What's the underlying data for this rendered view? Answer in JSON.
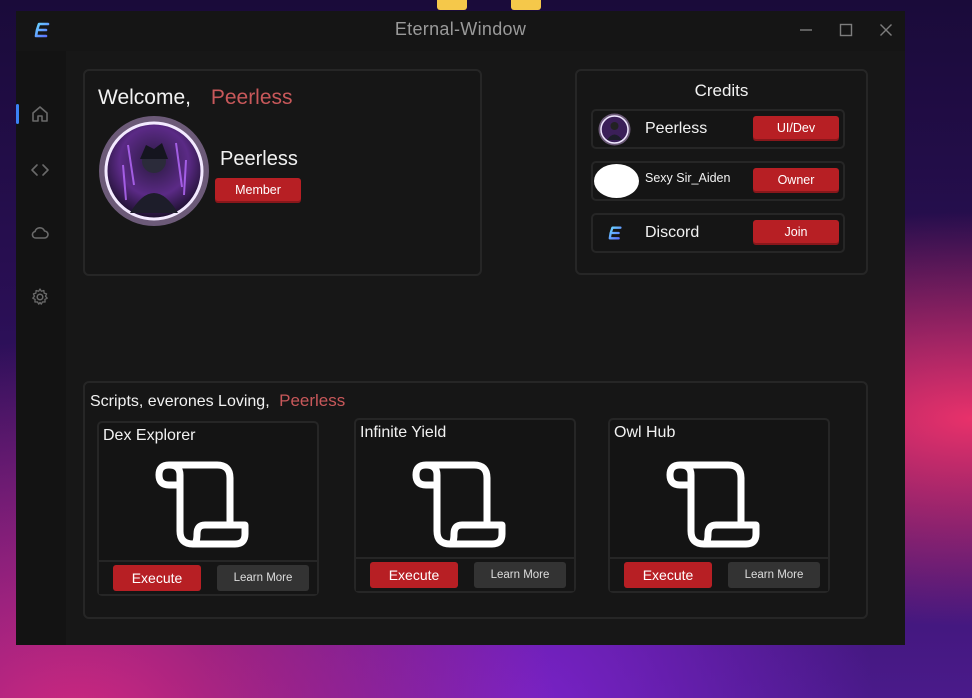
{
  "window": {
    "title": "Eternal-Window"
  },
  "colors": {
    "accent_red": "#b71f24",
    "name_red": "#c8585a",
    "active_indicator": "#3b82f6",
    "window_bg": "#151515"
  },
  "icons": {
    "app_logo": "eternal-e-icon",
    "nav": [
      "home-icon",
      "code-icon",
      "cloud-icon",
      "gear-icon"
    ],
    "window_controls": [
      "minimize-icon",
      "maximize-icon",
      "close-icon"
    ],
    "script": "scroll-icon"
  },
  "welcome": {
    "greeting": "Welcome,",
    "username": "Peerless",
    "profile_name": "Peerless",
    "role_badge": "Member"
  },
  "credits": {
    "title": "Credits",
    "items": [
      {
        "name": "Peerless",
        "role": "UI/Dev"
      },
      {
        "name": "Sexy Sir_Aiden",
        "role": "Owner"
      },
      {
        "name": "Discord",
        "role": "Join"
      }
    ]
  },
  "scripts": {
    "heading": "Scripts, everones Loving,",
    "username": "Peerless",
    "cards": [
      {
        "name": "Dex Explorer",
        "execute": "Execute",
        "learn_more": "Learn More"
      },
      {
        "name": "Infinite Yield",
        "execute": "Execute",
        "learn_more": "Learn More"
      },
      {
        "name": "Owl Hub",
        "execute": "Execute",
        "learn_more": "Learn More"
      }
    ]
  }
}
